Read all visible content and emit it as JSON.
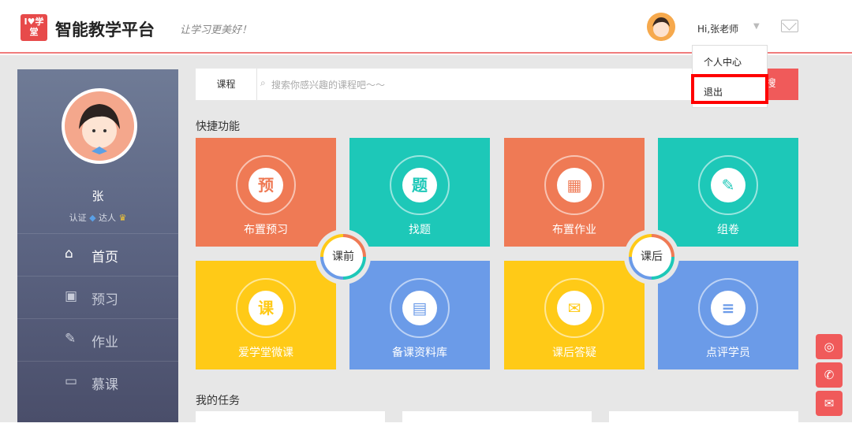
{
  "header": {
    "logo_text": "I♥学堂",
    "brand": "智能教学平台",
    "slogan": "让学习更美好！",
    "greeting": "Hi,张老师"
  },
  "dropdown": {
    "items": [
      "个人中心",
      "退出"
    ]
  },
  "sidebar": {
    "name": "张",
    "badges": {
      "cert": "认证",
      "expert": "达人"
    },
    "nav": [
      {
        "label": "首页",
        "icon": "home-icon"
      },
      {
        "label": "预习",
        "icon": "preview-icon"
      },
      {
        "label": "作业",
        "icon": "pencil-icon"
      },
      {
        "label": "慕课",
        "icon": "mooc-icon"
      }
    ]
  },
  "search": {
    "category": "课程",
    "placeholder": "搜索你感兴趣的课程吧～～",
    "button": "搜"
  },
  "quick": {
    "title": "快捷功能",
    "tiles": [
      {
        "label": "布置预习",
        "glyph": "预",
        "color": "#ef7a55",
        "icon": "preview-tile-icon"
      },
      {
        "label": "找题",
        "glyph": "题",
        "color": "#1dc8b8",
        "icon": "question-search-icon"
      },
      {
        "label": "布置作业",
        "glyph": "▦",
        "color": "#ef7a55",
        "icon": "calendar-icon"
      },
      {
        "label": "组卷",
        "glyph": "✎",
        "color": "#1dc8b8",
        "icon": "document-edit-icon"
      },
      {
        "label": "爱学堂微课",
        "glyph": "课",
        "color": "#ffca17",
        "icon": "micro-lesson-icon"
      },
      {
        "label": "备课资料库",
        "glyph": "▤",
        "color": "#6b9be8",
        "icon": "book-icon"
      },
      {
        "label": "课后答疑",
        "glyph": "✉",
        "color": "#ffca17",
        "icon": "chat-icon"
      },
      {
        "label": "点评学员",
        "glyph": "≡",
        "color": "#6b9be8",
        "icon": "comment-icon"
      }
    ],
    "phases": [
      "课前",
      "课后"
    ]
  },
  "tasks": {
    "title": "我的任务"
  }
}
